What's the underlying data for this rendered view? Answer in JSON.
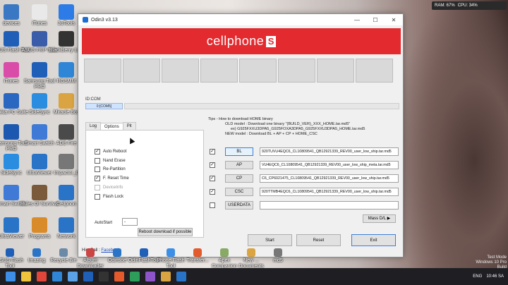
{
  "window": {
    "title": "Odin3 v3.13",
    "min": "—",
    "max": "☐",
    "close": "✕"
  },
  "banner": {
    "text": "cellphone",
    "badge": "S"
  },
  "status": {
    "idcom_label": "ID:COM",
    "port": "0:[COM5]"
  },
  "tabs": [
    "Log",
    "Options",
    "Pit"
  ],
  "options": [
    {
      "label": "Auto Reboot",
      "checked": true,
      "enabled": true
    },
    {
      "label": "Nand Erase",
      "checked": false,
      "enabled": true
    },
    {
      "label": "Re-Partition",
      "checked": false,
      "enabled": true
    },
    {
      "label": "F. Reset Time",
      "checked": true,
      "enabled": true
    },
    {
      "label": "DeviceInfo",
      "checked": false,
      "enabled": false
    },
    {
      "label": "Flash Lock",
      "checked": false,
      "enabled": true
    }
  ],
  "autostart": {
    "label": "AutoStart",
    "value": "-"
  },
  "reboot_button": "Reboot download if possible",
  "tips": {
    "title": "Tips - How to download HOME binary",
    "old_model": "OLD model : Download one binary   \"(BUILD_VER)_XXX_HOME.tar.md5\"",
    "old_example": "ex) G925FXXU3DPA5_G925FOXA3DPA5_G925FXXU3DPA5_HOME.tar.md5",
    "new_model": "NEW model : Download BL + AP + CP + HOME_CSC"
  },
  "files": [
    {
      "button": "BL",
      "checked": true,
      "path": "920TUVU4EQC6_CL10809541_QB12921339_REV00_user_low_ship.tar.md5"
    },
    {
      "button": "AP",
      "checked": true,
      "path": "VU4EQC6_CL10809541_QB12921339_REV00_user_low_ship_meta.tar.md5"
    },
    {
      "button": "CP",
      "checked": true,
      "path": "C6_CP6021475_CL10809541_QB12921339_REV00_user_low_ship.tar.md5"
    },
    {
      "button": "CSC",
      "checked": true,
      "path": "920TTMB4EQC6_CL10809541_QB12921339_REV00_user_low_ship.tar.md5"
    },
    {
      "button": "USERDATA",
      "checked": false,
      "path": ""
    }
  ],
  "mass_dl": "Mass D/L ▶",
  "actions": {
    "start": "Start",
    "reset": "Reset",
    "exit": "Exit"
  },
  "footer": {
    "prefix": "HieuBall : ",
    "link": "Facebook"
  },
  "desktop_icons": [
    {
      "label": "devices",
      "color": "#3b78c4"
    },
    {
      "label": "iTunes",
      "color": "#e9e9e9"
    },
    {
      "label": "3uTools",
      "color": "#2d7be6"
    },
    {
      "label": "ASUS Flash Tool",
      "color": "#1f5fb8"
    },
    {
      "label": "ASUS FRP Sale",
      "color": "#3b5ca8"
    },
    {
      "label": "BlackBerry Link",
      "color": "#333"
    },
    {
      "label": "iTunes",
      "color": "#d94ca8"
    },
    {
      "label": "Samsung Tool PRO",
      "color": "#1f5fb8"
    },
    {
      "label": "RGSMM",
      "color": "#2f86d6"
    },
    {
      "label": "Nokia PC Suite",
      "color": "#2a67c0"
    },
    {
      "label": "SideSync",
      "color": "#2b8de0"
    },
    {
      "label": "Miracle Box",
      "color": "#d9a441"
    },
    {
      "label": "Samsung Tool PRO",
      "color": "#1c57b0"
    },
    {
      "label": "Smart Switch",
      "color": "#3f7ad6"
    },
    {
      "label": "ADB Fire",
      "color": "#4a4a4a"
    },
    {
      "label": "SideSync",
      "color": "#2b8de0"
    },
    {
      "label": "UltraViewer",
      "color": "#2a74c8"
    },
    {
      "label": "Impactor_0",
      "color": "#777"
    },
    {
      "label": "Smart Switch",
      "color": "#3f7ad6"
    },
    {
      "label": "Rules Of Survival",
      "color": "#7a5a3a"
    },
    {
      "label": "Cellphon",
      "color": "#2a74c8"
    },
    {
      "label": "UltraViewer",
      "color": "#2a74c8"
    },
    {
      "label": "Programs",
      "color": "#d98b2a"
    },
    {
      "label": "Network",
      "color": "#2a74c8"
    }
  ],
  "bottom_icons": [
    "ASUS Flash Tool",
    "Imazing",
    "Recycle Bin",
    "Album Downloader",
    "Odinsoe",
    "OdinFlashTool",
    "Phone Flash Tool",
    "Transfer...",
    "Apex Companion",
    "New ... Documents",
    "md5"
  ],
  "tray": {
    "ram": "RAM: 67%",
    "cpu": "CPU: 34%"
  },
  "taskbar": {
    "lang": "ENG",
    "time": "10:46 SA"
  },
  "watermark": {
    "line1": "Test Mode",
    "line2": "Windows 10 Pro",
    "line3": "Build 16299.rs3_release.170928-1534"
  }
}
